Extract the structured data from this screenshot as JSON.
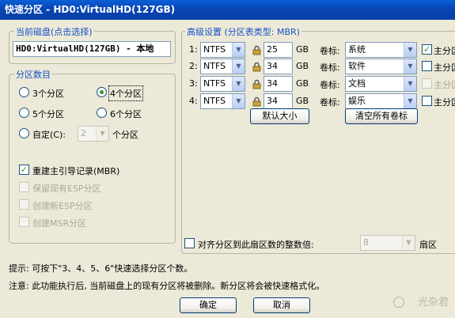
{
  "window": {
    "title": "快速分区 - HD0:VirtualHD(127GB)"
  },
  "current_disk": {
    "legend": "当前磁盘(点击选择)",
    "value": "HD0:VirtualHD(127GB) - 本地"
  },
  "partition_count": {
    "legend": "分区数目",
    "options": [
      "3个分区",
      "4个分区",
      "5个分区",
      "6个分区"
    ],
    "selected": "4个分区",
    "custom_label": "自定(C):",
    "custom_value": "2",
    "custom_suffix": "个分区"
  },
  "options": {
    "rebuild_mbr": {
      "label": "重建主引导记录(MBR)",
      "checked": true
    },
    "keep_esp": {
      "label": "保留现有ESP分区",
      "checked": false
    },
    "create_esp": {
      "label": "创建新ESP分区",
      "checked": false
    },
    "create_msr": {
      "label": "创建MSR分区",
      "checked": false
    }
  },
  "advanced": {
    "legend": "高级设置 (分区表类型: MBR)",
    "size_unit": "GB",
    "volume_label": "卷标:",
    "primary_label": "主分区",
    "rows": [
      {
        "index": "1:",
        "fs": "NTFS",
        "size": "25",
        "volume": "系统",
        "primary": true
      },
      {
        "index": "2:",
        "fs": "NTFS",
        "size": "34",
        "volume": "软件",
        "primary": false
      },
      {
        "index": "3:",
        "fs": "NTFS",
        "size": "34",
        "volume": "文档",
        "primary": false
      },
      {
        "index": "4:",
        "fs": "NTFS",
        "size": "34",
        "volume": "娱乐",
        "primary": false
      }
    ],
    "default_size_button": "默认大小",
    "clear_labels_button": "清空所有卷标"
  },
  "align": {
    "label": "对齐分区到此扇区数的整数倍:",
    "value": "8",
    "suffix": "扇区",
    "checked": false
  },
  "hints": {
    "hint": "提示: 可按下\"3、4、5、6\"快速选择分区个数。",
    "warning": "注意: 此功能执行后, 当前磁盘上的现有分区将被删除。新分区将会被快速格式化。"
  },
  "buttons": {
    "ok": "确定",
    "cancel": "取消"
  },
  "watermark": "光杂君",
  "colors": {
    "title_bar": "#0847b5",
    "legend_text": "#1550c7",
    "dialog_bg": "#ece9d8"
  }
}
